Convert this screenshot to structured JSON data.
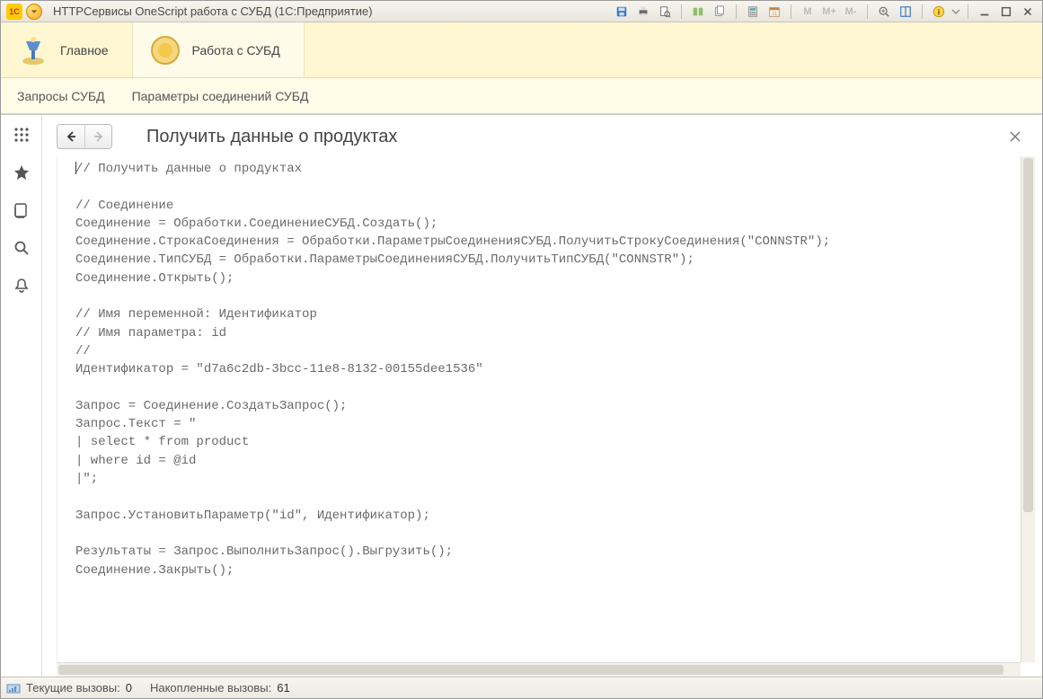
{
  "titlebar": {
    "title": "HTTPСервисы OneScript работа с СУБД  (1С:Предприятие)"
  },
  "section_tabs": [
    {
      "label": "Главное",
      "icon": "lamp-icon",
      "active": false
    },
    {
      "label": "Работа с СУБД",
      "icon": "gold-circle-icon",
      "active": true
    }
  ],
  "submenu": [
    "Запросы СУБД",
    "Параметры соединений СУБД"
  ],
  "page": {
    "title": "Получить данные о продуктах",
    "code": "// Получить данные о продуктах\n\n// Соединение\nСоединение = Обработки.СоединениеСУБД.Создать();\nСоединение.СтрокаСоединения = Обработки.ПараметрыСоединенияСУБД.ПолучитьСтрокуСоединения(\"CONNSTR\");\nСоединение.ТипСУБД = Обработки.ПараметрыСоединенияСУБД.ПолучитьТипСУБД(\"CONNSTR\");\nСоединение.Открыть();\n\n// Имя переменной: Идентификатор\n// Имя параметра: id\n//\nИдентификатор = \"d7a6c2db-3bcc-11e8-8132-00155dee1536\"\n\nЗапрос = Соединение.СоздатьЗапрос();\nЗапрос.Текст = \"\n| select * from product\n| where id = @id\n|\";\n\nЗапрос.УстановитьПараметр(\"id\", Идентификатор);\n\nРезультаты = Запрос.ВыполнитьЗапрос().Выгрузить();\nСоединение.Закрыть();"
  },
  "statusbar": {
    "current_label": "Текущие вызовы:",
    "current_value": "0",
    "accum_label": "Накопленные вызовы:",
    "accum_value": "61"
  },
  "toolbar_letters": {
    "m1": "M",
    "m2": "M+",
    "m3": "M-"
  }
}
